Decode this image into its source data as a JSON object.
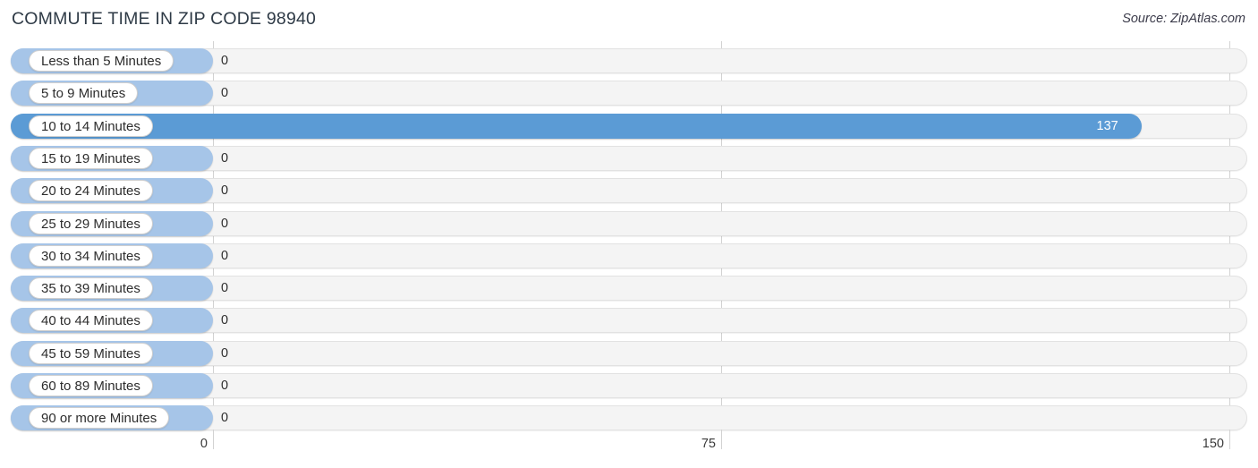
{
  "header": {
    "title": "COMMUTE TIME IN ZIP CODE 98940",
    "source": "Source: ZipAtlas.com"
  },
  "colors": {
    "bar_pale": "#a6c5e8",
    "bar_solid": "#5b9bd5",
    "track": "#f4f4f4",
    "gridline": "#d2d2d2",
    "title_text": "#2e3a46"
  },
  "chart_data": {
    "type": "bar",
    "orientation": "horizontal",
    "title": "COMMUTE TIME IN ZIP CODE 98940",
    "xlabel": "",
    "ylabel": "",
    "xlim": [
      0,
      150
    ],
    "xticks": [
      "0",
      "75",
      "150"
    ],
    "xtick_values": [
      0,
      75,
      150
    ],
    "grid": true,
    "legend": null,
    "categories": [
      "Less than 5 Minutes",
      "5 to 9 Minutes",
      "10 to 14 Minutes",
      "15 to 19 Minutes",
      "20 to 24 Minutes",
      "25 to 29 Minutes",
      "30 to 34 Minutes",
      "35 to 39 Minutes",
      "40 to 44 Minutes",
      "45 to 59 Minutes",
      "60 to 89 Minutes",
      "90 or more Minutes"
    ],
    "values": [
      0,
      0,
      137,
      0,
      0,
      0,
      0,
      0,
      0,
      0,
      0,
      0
    ],
    "value_labels": [
      "0",
      "0",
      "137",
      "0",
      "0",
      "0",
      "0",
      "0",
      "0",
      "0",
      "0",
      "0"
    ]
  }
}
